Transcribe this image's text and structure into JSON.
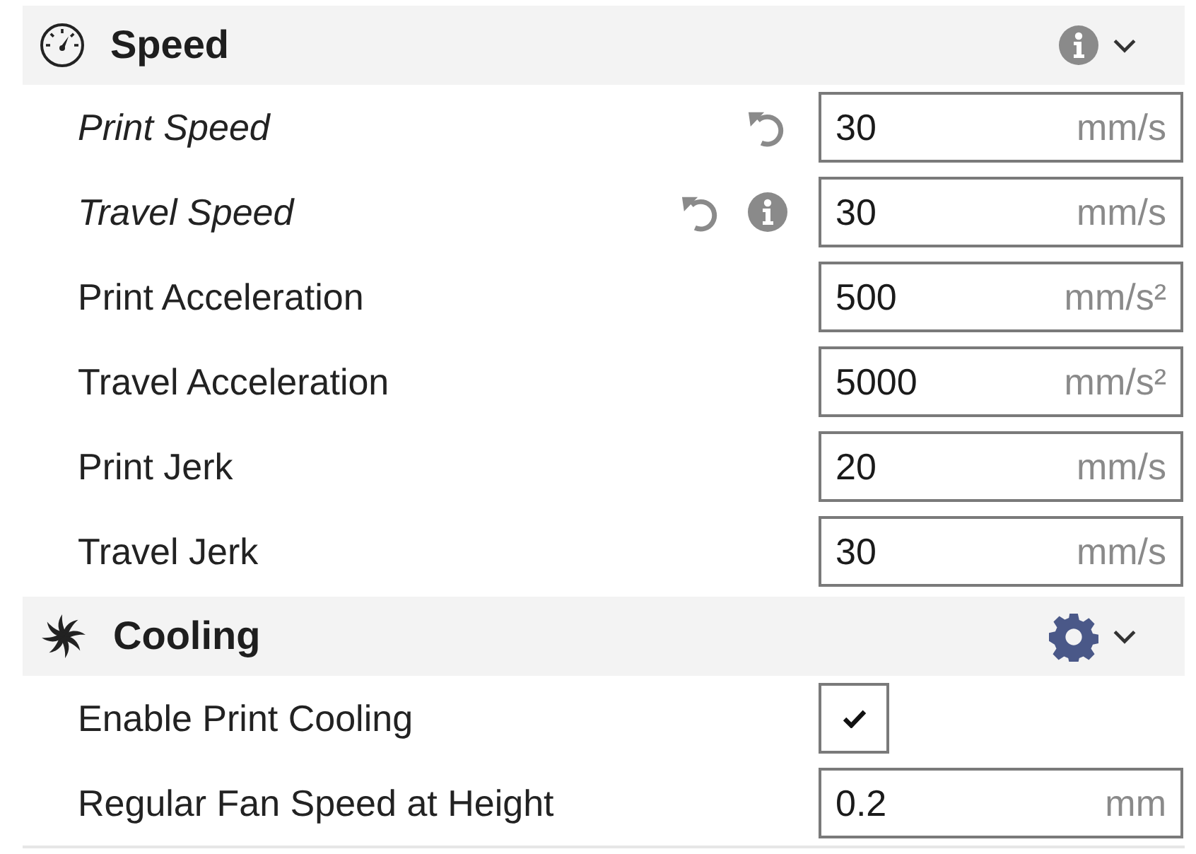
{
  "sections": [
    {
      "kind": "speed",
      "title": "Speed",
      "expanded": true,
      "settings": [
        {
          "kind": "number",
          "label": "Print Speed",
          "modified": true,
          "overridden": false,
          "value": "30",
          "unit": "mm/s"
        },
        {
          "kind": "number",
          "label": "Travel Speed",
          "modified": true,
          "overridden": true,
          "value": "30",
          "unit": "mm/s"
        },
        {
          "kind": "number",
          "label": "Print Acceleration",
          "modified": false,
          "overridden": false,
          "value": "500",
          "unit": "mm/s²"
        },
        {
          "kind": "number",
          "label": "Travel Acceleration",
          "modified": false,
          "overridden": false,
          "value": "5000",
          "unit": "mm/s²"
        },
        {
          "kind": "number",
          "label": "Print Jerk",
          "modified": false,
          "overridden": false,
          "value": "20",
          "unit": "mm/s"
        },
        {
          "kind": "number",
          "label": "Travel Jerk",
          "modified": false,
          "overridden": false,
          "value": "30",
          "unit": "mm/s"
        }
      ]
    },
    {
      "kind": "cooling",
      "title": "Cooling",
      "expanded": true,
      "settings": [
        {
          "kind": "checkbox",
          "label": "Enable Print Cooling",
          "modified": false,
          "overridden": false,
          "checked": true
        },
        {
          "kind": "number",
          "label": "Regular Fan Speed at Height",
          "modified": false,
          "overridden": false,
          "value": "0.2",
          "unit": "mm"
        }
      ]
    }
  ]
}
